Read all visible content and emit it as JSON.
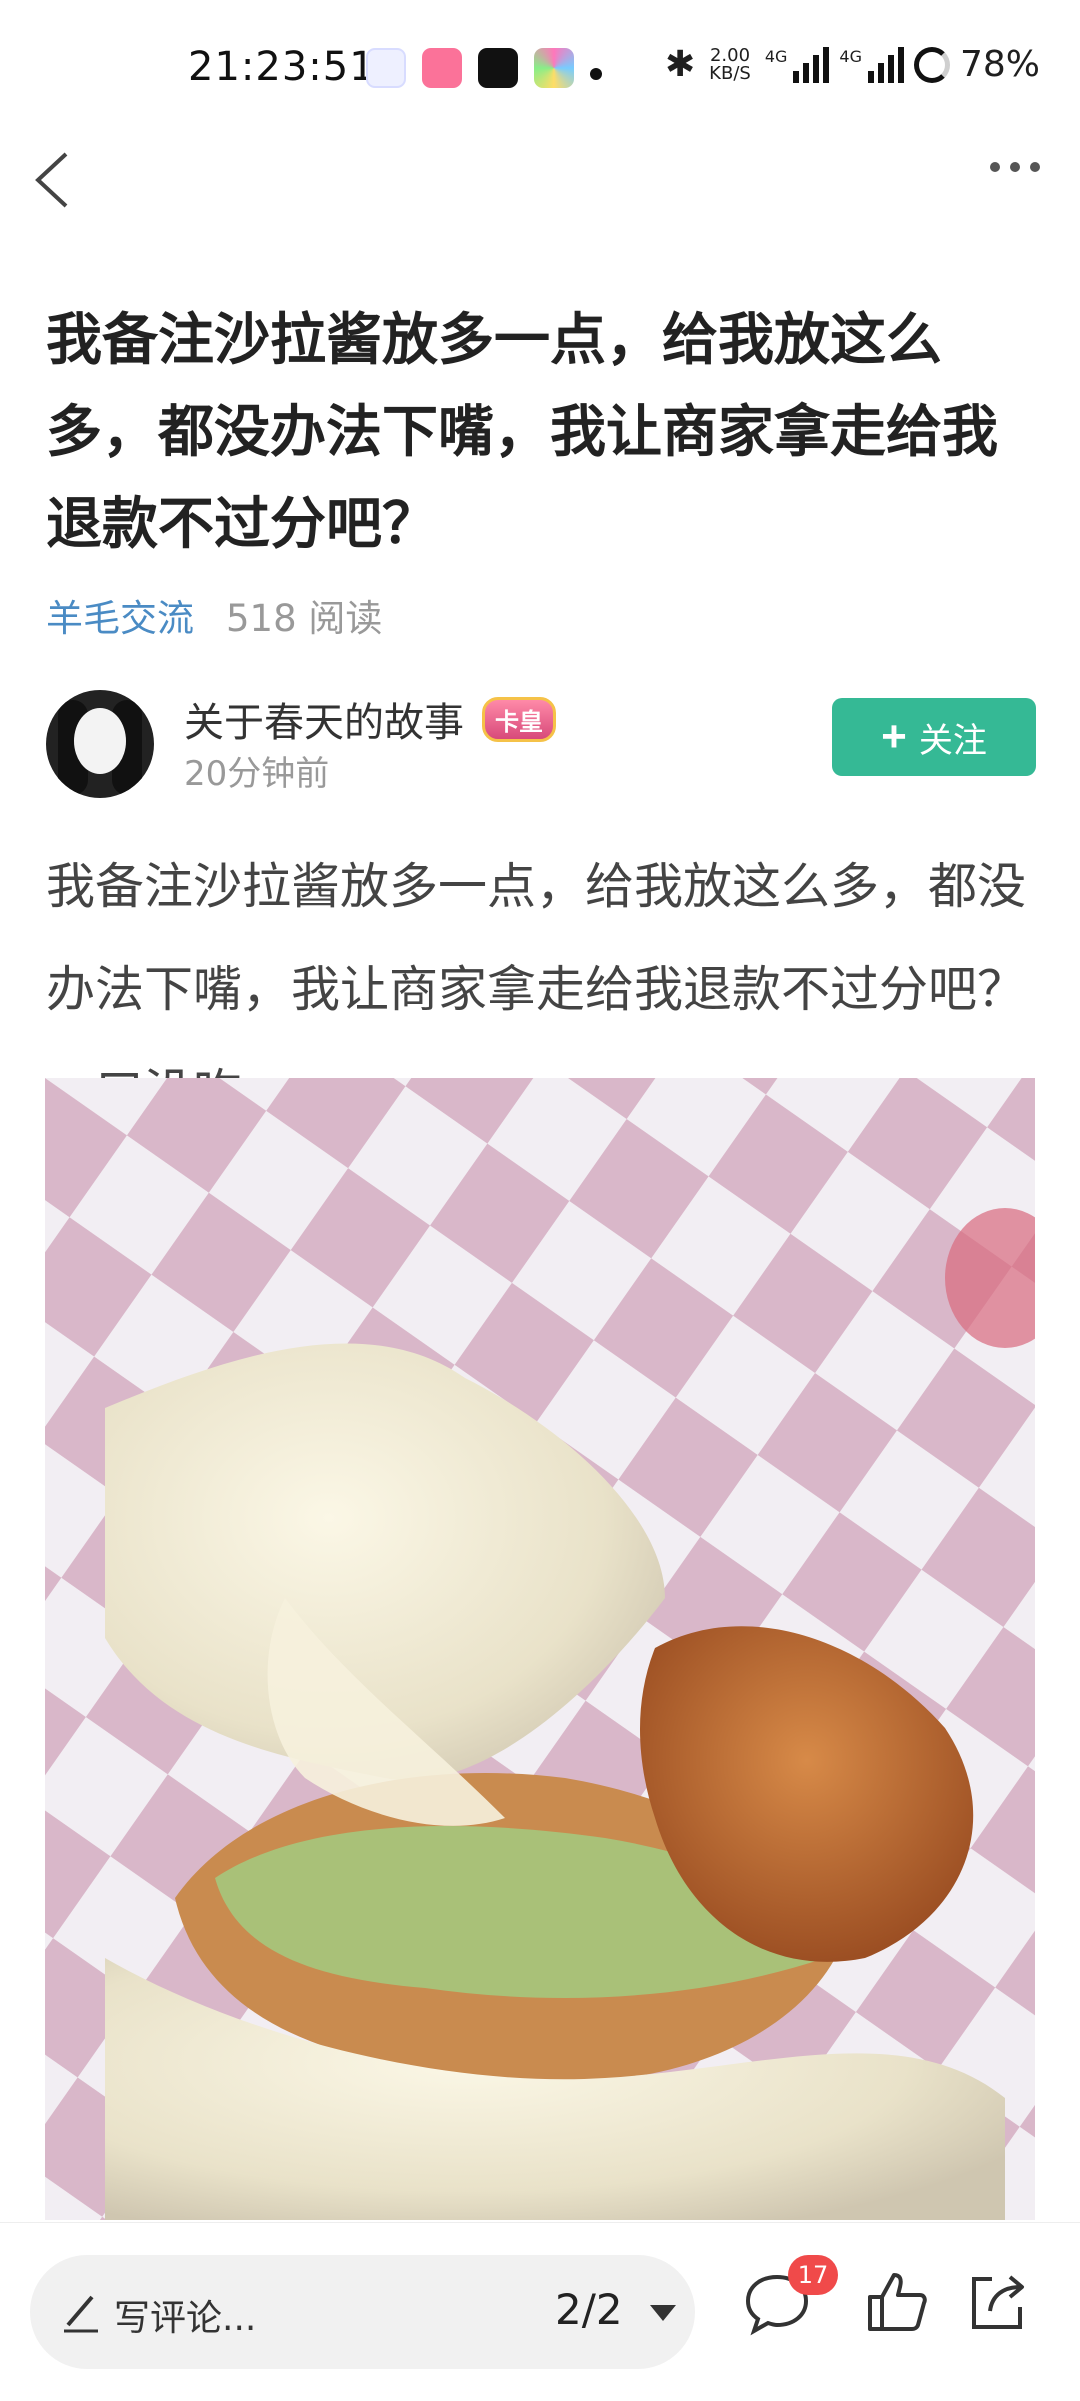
{
  "status_bar": {
    "time": "21:23:51",
    "app_icons": [
      {
        "name": "cloud-app-icon",
        "color": "#e8eaff"
      },
      {
        "name": "bilibili-icon",
        "color": "#fb7299"
      },
      {
        "name": "tiktok-icon",
        "color": "#111111"
      },
      {
        "name": "colorful-app-icon",
        "color": "#f0f0f0"
      }
    ],
    "net_speed_value": "2.00",
    "net_speed_unit": "KB/S",
    "network_1": "4G",
    "network_2": "4G",
    "battery": "78%",
    "battery_level": 0.78
  },
  "nav": {
    "back_icon": "chevron-left-icon",
    "more_icon": "more-dots-icon"
  },
  "post": {
    "title": "我备注沙拉酱放多一点，给我放这么多，都没办法下嘴，我让商家拿走给我退款不过分吧？",
    "category": "羊毛交流",
    "views": "518 阅读",
    "author": {
      "name": "关于春天的故事",
      "badge": "卡皇",
      "time": "20分钟前"
    },
    "follow_label": "关注",
    "body": "我备注沙拉酱放多一点，给我放这么多，都没办法下嘴，我让商家拿走给我退款不过分吧？一口没吃"
  },
  "bottom": {
    "comment_placeholder": "写评论...",
    "pager": "2/2",
    "comment_count": "17"
  },
  "colors": {
    "accent_green": "#35b995",
    "category_blue": "#4a8bc4",
    "badge_red": "#f04a4a"
  }
}
